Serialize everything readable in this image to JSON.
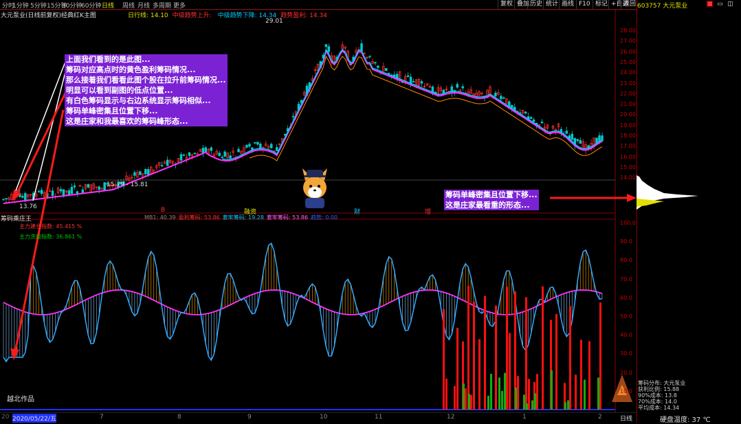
{
  "header": {
    "period_tabs": [
      "分时",
      "1分钟",
      "5分钟",
      "15分钟",
      "30分钟",
      "60分钟",
      "日线",
      "周线",
      "月线",
      "多周期",
      "更多"
    ],
    "active_tab": "日线",
    "top_right_buttons": [
      "复权",
      "叠加",
      "历史",
      "统计",
      "画线",
      "F10",
      "标记",
      "+自选",
      "返回"
    ]
  },
  "stock": {
    "code_name": "603757 大元泵业",
    "chart_title": "大元泵业(日线前复权)",
    "indicator_name": "经典红K主图",
    "ma_labels": [
      {
        "text": "日行线: 14.10",
        "color": "#e0e000"
      },
      {
        "text": "中级趋势上升: ",
        "color": "#ff3030"
      },
      {
        "text": "中级趋势下降: 14.34",
        "color": "#00c8ff"
      },
      {
        "text": "趋势盈利: 14.34",
        "color": "#ff3030"
      }
    ]
  },
  "main_chart": {
    "high_label": "29.01",
    "low_label": "13.76",
    "range_label": "15.79 - 15.81",
    "event_labels": [
      {
        "text": "B",
        "color": "#ff3030"
      },
      {
        "text": "融资",
        "color": "#e0e000"
      },
      {
        "text": "财",
        "color": "#00c8ff"
      },
      {
        "text": "增",
        "color": "#ff3030"
      }
    ],
    "y_ticks": [
      "28.00",
      "27.00",
      "26.00",
      "25.00",
      "24.00",
      "23.00",
      "22.00",
      "21.00",
      "20.00",
      "19.00",
      "18.00",
      "17.00",
      "16.00",
      "15.00",
      "14.00"
    ]
  },
  "sub_chart": {
    "title": "筹码乘庄王",
    "indicator_values": [
      {
        "text": "MB1: 40.39",
        "color": "#888888"
      },
      {
        "text": "盈利筹码: 53.86",
        "color": "#ff3030"
      },
      {
        "text": "套牢筹码: 19.28",
        "color": "#00c8ff"
      },
      {
        "text": "套牢筹码: 53.86",
        "color": "#ff66ff"
      },
      {
        "text": "趋势: 0.00",
        "color": "#3060ff"
      }
    ],
    "legend": [
      {
        "text": "主力建仓指数: ",
        "value": "45.415 %",
        "color": "#ff3030"
      },
      {
        "text": "主力洗盘指数: ",
        "value": "36.861 %",
        "color": "#00c000"
      }
    ],
    "y_ticks": [
      "100.0",
      "90.0",
      "80.0",
      "70.0",
      "60.0",
      "50.0",
      "40.0",
      "30.0",
      "20.0",
      "10.0"
    ],
    "author_label": "越北作品"
  },
  "callouts": {
    "left_lines": [
      "上面我们看到的是此图...",
      "筹码对应高点时的黄色盈利筹码情况...",
      "那么接着我们看看此图个股在拉升前筹码情况...",
      "明显可以看到副图的低点位置...",
      "有白色筹码显示与右边系统显示筹码相似...",
      "筹码单峰密集且位置下移...",
      "这是庄家和我最喜欢的筹码峰形态..."
    ],
    "right_lines": [
      "筹码单峰密集且位置下移...",
      "这是庄家最看重的形态..."
    ]
  },
  "bottom": {
    "date": "2020/05/22/五",
    "date_prefix": "20",
    "x_ticks": [
      "7",
      "8",
      "9",
      "10",
      "11",
      "12",
      "1",
      "2"
    ],
    "right_label": "日线",
    "cpu_temp": "硬盘温度: 37 ℃"
  },
  "right_panel": {
    "stats_lines": [
      "筹码分布: 大元泵业",
      "获利比例: 15.88",
      "90%成本: 13.8",
      "70%成本: 14.0",
      "平均成本: 14.34"
    ]
  },
  "colors": {
    "up": "#ff3030",
    "down": "#00c8c8",
    "ma": "#ff33ff",
    "ma2": "#00c8ff",
    "callout": "#7b22d4",
    "arrow": "#ff1a1a"
  }
}
